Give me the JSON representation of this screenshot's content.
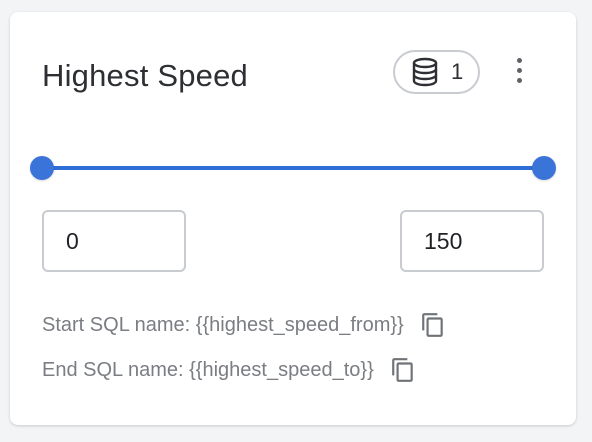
{
  "widget": {
    "title": "Highest Speed",
    "datasource_count": "1",
    "icons": {
      "datasource": "database-icon",
      "menu": "kebab-menu-icon",
      "copy": "copy-icon"
    }
  },
  "range": {
    "from_value": "0",
    "to_value": "150",
    "selected_fraction_start": 0,
    "selected_fraction_end": 1
  },
  "sql": {
    "start_text": "Start SQL name: {{highest_speed_from}}",
    "end_text": "End SQL name: {{highest_speed_to}}"
  },
  "colors": {
    "accent": "#3b74d9",
    "text": "#2d2f33",
    "muted": "#7a7d82",
    "border": "#c8cbd0"
  }
}
